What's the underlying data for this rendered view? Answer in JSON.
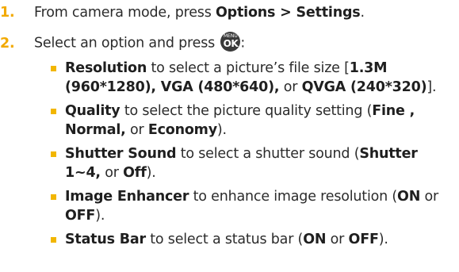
{
  "step1": {
    "number": "1.",
    "text": "From camera mode, press ",
    "menu_path": "Options > Settings",
    "end": "."
  },
  "step2": {
    "number": "2.",
    "text": "Select an option and press ",
    "key_top": "MENU",
    "key_main": "OK",
    "end": ":"
  },
  "options": [
    {
      "name": "Resolution",
      "desc": " to select a picture’s file size [",
      "v1": "1.3M (960*1280), VGA (480*640),",
      "mid": " or ",
      "v2": "QVGA (240*320)",
      "end": "]."
    },
    {
      "name": "Quality",
      "desc": " to select the picture quality setting (",
      "v1": "Fine ,",
      "sep": " ",
      "v2": "Normal,",
      "mid": " or ",
      "v3": "Economy",
      "end": ")."
    },
    {
      "name": "Shutter Sound",
      "desc": " to select a shutter sound (",
      "v1": "Shutter 1~4,",
      "mid": " or ",
      "v2": "Off",
      "end": ")."
    },
    {
      "name": "Image Enhancer",
      "desc": " to enhance image resolution (",
      "v1": "ON",
      "mid": " or ",
      "v2": "OFF",
      "end": ")."
    },
    {
      "name": "Status Bar",
      "desc": " to select a status bar (",
      "v1": "ON",
      "mid": " or ",
      "v2": "OFF",
      "end": ")."
    }
  ]
}
